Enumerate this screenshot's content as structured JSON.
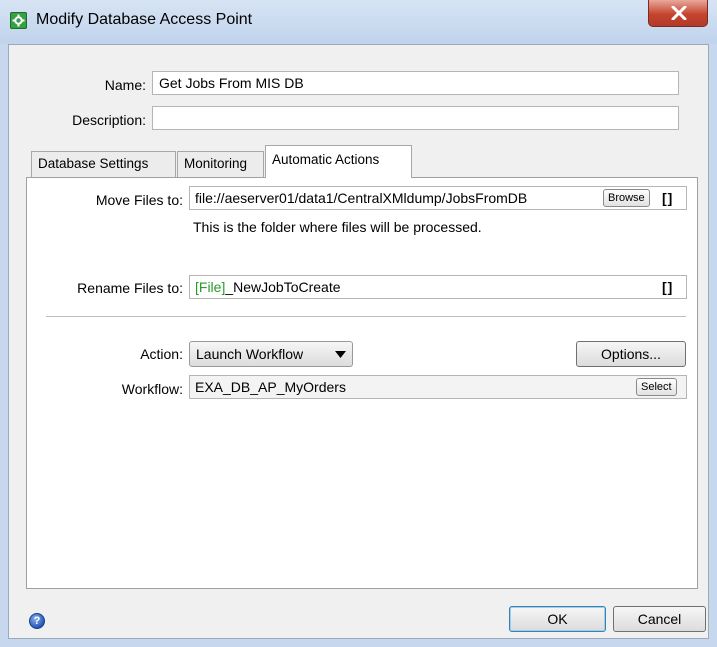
{
  "window": {
    "title": "Modify Database Access Point",
    "app_icon": "gear-icon",
    "close_icon": "close-icon"
  },
  "form": {
    "name_label": "Name:",
    "name_value": "Get Jobs From MIS DB",
    "description_label": "Description:",
    "description_value": ""
  },
  "tabs": [
    {
      "label": "Database Settings",
      "active": false
    },
    {
      "label": "Monitoring",
      "active": false
    },
    {
      "label": "Automatic Actions",
      "active": true
    }
  ],
  "automatic_actions": {
    "move_label": "Move Files to:",
    "move_value": "file://aeserver01/data1/CentralXMldump/JobsFromDB",
    "browse_label": "Browse",
    "move_bracket": "[]",
    "move_hint": "This is the folder where files will be processed.",
    "rename_label": "Rename Files to:",
    "rename_token": "[File]",
    "rename_suffix": "_NewJobToCreate",
    "rename_bracket": "[]",
    "action_label": "Action:",
    "action_value": "Launch Workflow",
    "options_label": "Options...",
    "workflow_label": "Workflow:",
    "workflow_value": "EXA_DB_AP_MyOrders",
    "select_label": "Select"
  },
  "footer": {
    "help_icon": "help-icon",
    "help_glyph": "?",
    "ok_label": "OK",
    "cancel_label": "Cancel"
  },
  "colors": {
    "title_bar": "#c9d9ef",
    "close_button": "#c5442e",
    "token_green": "#2a9a2a"
  }
}
